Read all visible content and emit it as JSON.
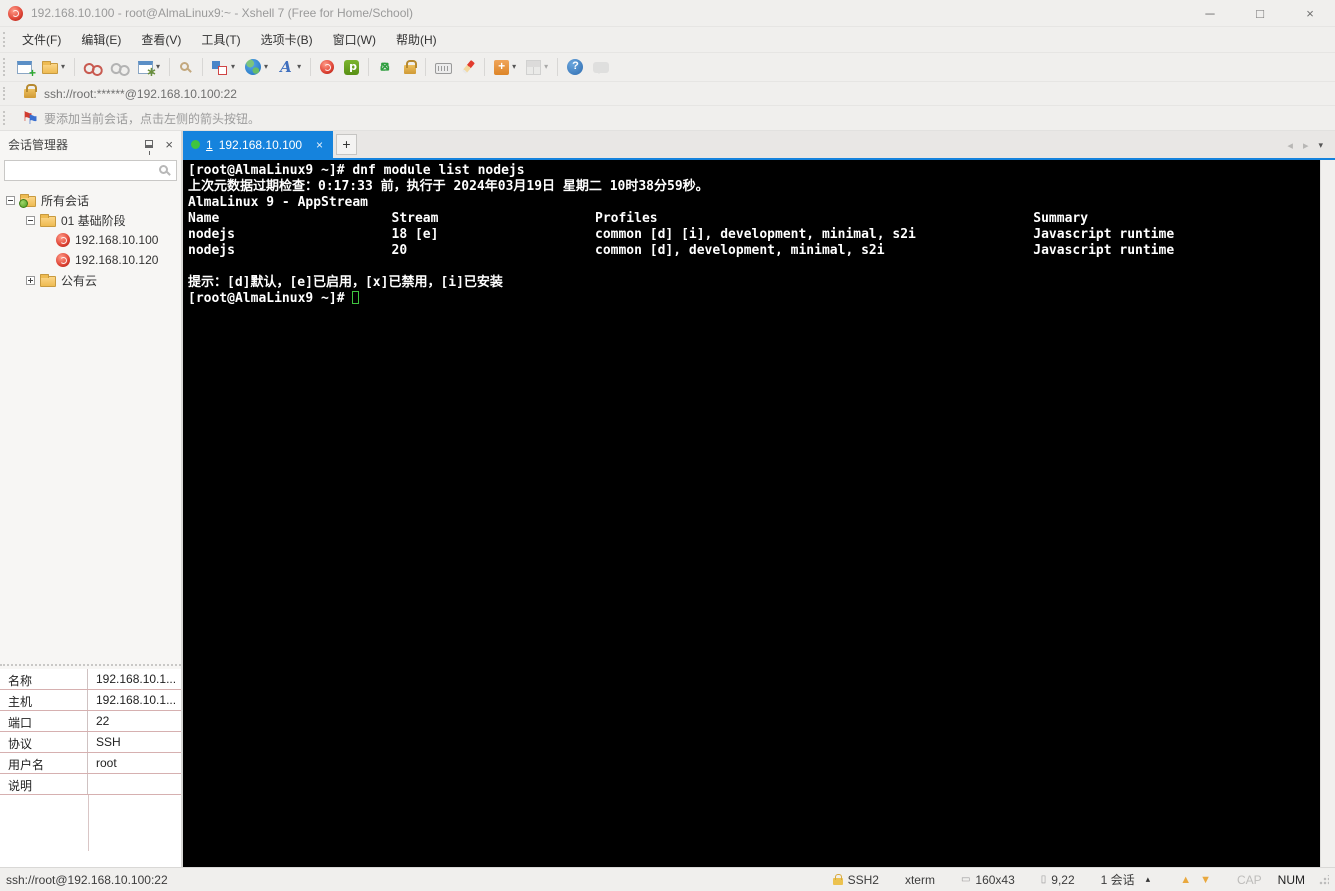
{
  "window": {
    "title": "192.168.10.100 - root@AlmaLinux9:~ - Xshell 7 (Free for Home/School)"
  },
  "icons": {
    "minimize": "─",
    "maximize": "□",
    "close": "×",
    "flag": "⚑",
    "chevron_left": "◂",
    "chevron_right": "▸",
    "dropdown": "▾",
    "menu_up": "▴",
    "arrow_up": "▲",
    "arrow_down": "▼",
    "size_icon": "▭",
    "cursor_icon": "▯",
    "toolbar_names": [
      "new-session",
      "open-folder",
      "disconnect",
      "reconnect",
      "session-properties",
      "find",
      "layout",
      "encoding-globe",
      "font",
      "xshell",
      "xftp",
      "fullscreen",
      "lock",
      "keyboard",
      "highlight",
      "new-file",
      "tile-windows",
      "help",
      "feedback"
    ]
  },
  "menu": {
    "items": [
      {
        "label": "文件(F)"
      },
      {
        "label": "编辑(E)"
      },
      {
        "label": "查看(V)"
      },
      {
        "label": "工具(T)"
      },
      {
        "label": "选项卡(B)"
      },
      {
        "label": "窗口(W)"
      },
      {
        "label": "帮助(H)"
      }
    ]
  },
  "address_bar": {
    "url": "ssh://root:******@192.168.10.100:22"
  },
  "info_bar": {
    "text": "要添加当前会话，点击左侧的箭头按钮。"
  },
  "session_manager": {
    "title": "会话管理器",
    "tree": [
      {
        "label": "所有会话"
      },
      {
        "label": "01 基础阶段"
      },
      {
        "label": "192.168.10.100"
      },
      {
        "label": "192.168.10.120"
      },
      {
        "label": "公有云"
      }
    ]
  },
  "tabs": {
    "active_num": "1",
    "active_label": "192.168.10.100",
    "close": "×",
    "new_tab": "+"
  },
  "terminal": {
    "lines": [
      "[root@AlmaLinux9 ~]# dnf module list nodejs",
      "上次元数据过期检查：0:17:33 前，执行于 2024年03月19日 星期二 10时38分59秒。",
      "AlmaLinux 9 - AppStream",
      "Name                      Stream                    Profiles                                                Summary",
      "nodejs                    18 [e]                    common [d] [i], development, minimal, s2i               Javascript runtime",
      "nodejs                    20                        common [d], development, minimal, s2i                   Javascript runtime",
      "",
      "提示：[d]默认，[e]已启用，[x]已禁用，[i]已安装"
    ],
    "prompt": "[root@AlmaLinux9 ~]# "
  },
  "properties": {
    "rows": [
      {
        "label": "名称",
        "value": "192.168.10.1..."
      },
      {
        "label": "主机",
        "value": "192.168.10.1..."
      },
      {
        "label": "端口",
        "value": "22"
      },
      {
        "label": "协议",
        "value": "SSH"
      },
      {
        "label": "用户名",
        "value": "root"
      },
      {
        "label": "说明",
        "value": ""
      }
    ]
  },
  "status_bar": {
    "url": "ssh://root@192.168.10.100:22",
    "encryption": "SSH2",
    "terminal_type": "xterm",
    "screen_size": "160x43",
    "cursor_position": "9,22",
    "session_count": "1 会话",
    "cap": "CAP",
    "num": "NUM"
  }
}
